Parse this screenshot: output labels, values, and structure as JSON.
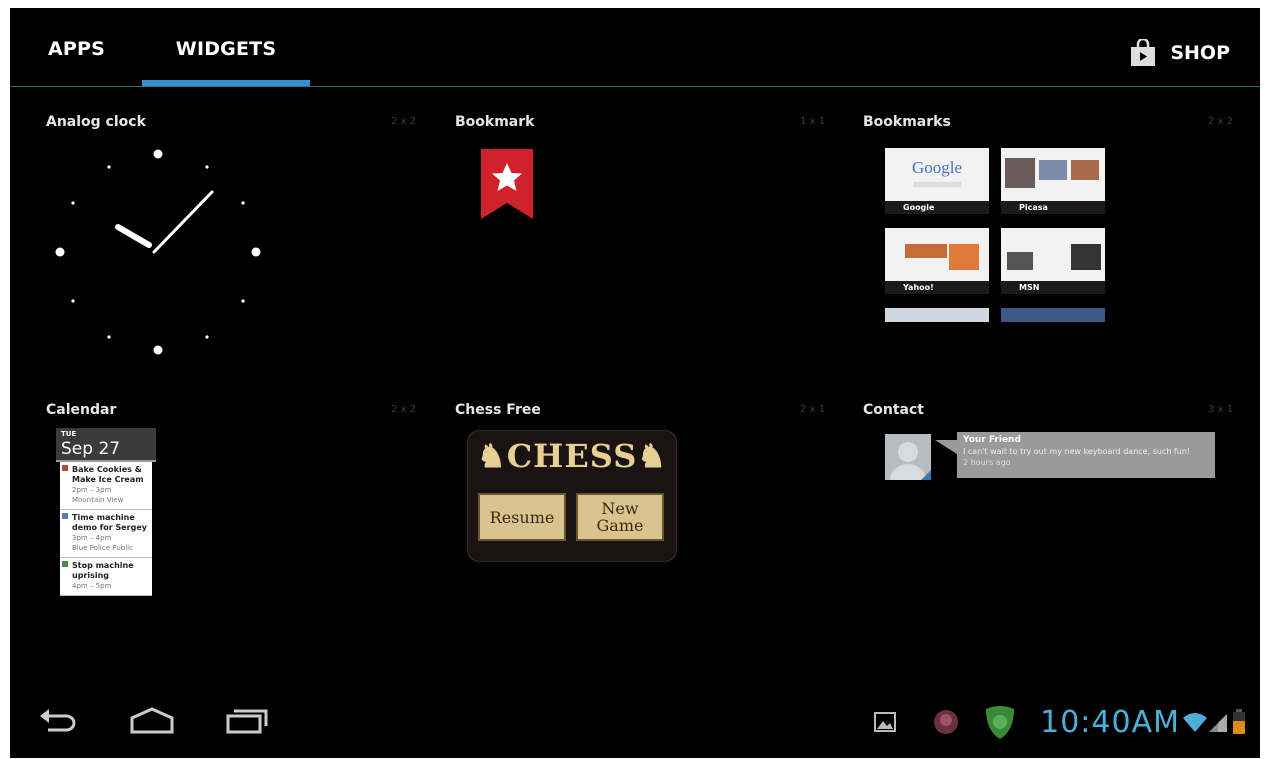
{
  "tabs": {
    "apps": "APPS",
    "widgets": "WIDGETS",
    "shop": "SHOP"
  },
  "widgets": [
    {
      "name": "Analog clock",
      "size": "2 x 2"
    },
    {
      "name": "Bookmark",
      "size": "1 x 1"
    },
    {
      "name": "Bookmarks",
      "size": "2 x 2"
    },
    {
      "name": "Calendar",
      "size": "2 x 2"
    },
    {
      "name": "Chess Free",
      "size": "2 x 1"
    },
    {
      "name": "Contact",
      "size": "3 x 1"
    }
  ],
  "bookmarks": {
    "items": [
      "Google",
      "Picasa",
      "Yahoo!",
      "MSN"
    ],
    "google_logo": "Google"
  },
  "calendar": {
    "day": "TUE",
    "date": "Sep 27",
    "events": [
      {
        "title": "Bake Cookies & Make Ice Cream",
        "time": "2pm – 3pm",
        "place": "Mountain View",
        "color": "#b04a3a"
      },
      {
        "title": "Time machine demo for Sergey",
        "time": "3pm – 4pm",
        "place": "Blue Police Public",
        "color": "#5a7ab0"
      },
      {
        "title": "Stop machine uprising",
        "time": "4pm – 5pm",
        "place": "",
        "color": "#4a8a4a"
      }
    ]
  },
  "chess": {
    "title": "CHESS",
    "resume": "Resume",
    "new_game_1": "New",
    "new_game_2": "Game"
  },
  "contact": {
    "name": "Your Friend",
    "message": "I can't wait to try out my new keyboard dance, such fun!",
    "time": "2 hours ago"
  },
  "status": {
    "time": "10:40AM"
  },
  "icons": {
    "back": "back-icon",
    "home": "home-icon",
    "recents": "recent-apps-icon",
    "shop": "shopping-bag-icon",
    "gallery": "gallery-notification-icon",
    "wifi": "wifi-icon",
    "signal": "signal-icon",
    "battery": "battery-icon"
  },
  "colors": {
    "tab_indicator": "#3a8fd4",
    "clock": "#4ab0d8",
    "bookmark_red": "#d0222a"
  }
}
